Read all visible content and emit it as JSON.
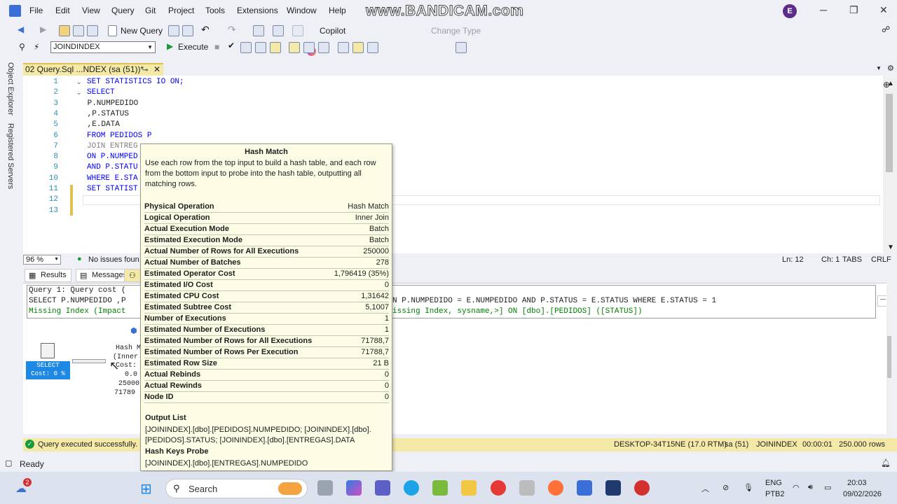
{
  "menu": [
    "File",
    "Edit",
    "View",
    "Query",
    "Git",
    "Project",
    "Tools",
    "Extensions",
    "Window",
    "Help"
  ],
  "watermark": "www.BANDICAM.com",
  "avatar_initial": "E",
  "toolbar": {
    "new_query": "New Query",
    "copilot": "Copilot",
    "change_type": "Change Type",
    "database": "JOINDINDEX",
    "execute": "Execute"
  },
  "left_panels": [
    "Object Explorer",
    "Registered Servers"
  ],
  "doc_tab": "02 Query.Sql ...NDEX (sa (51))*",
  "editor": {
    "lines": [
      {
        "n": "1",
        "text": "SET STATISTICS IO ON;"
      },
      {
        "n": "2",
        "text": "SELECT"
      },
      {
        "n": "3",
        "text": " P.NUMPEDIDO"
      },
      {
        "n": "4",
        "text": " ,P.STATUS"
      },
      {
        "n": "5",
        "text": " ,E.DATA"
      },
      {
        "n": "6",
        "text": "FROM PEDIDOS P"
      },
      {
        "n": "7",
        "text": "JOIN ENTREG"
      },
      {
        "n": "8",
        "text": "ON P.NUMPED"
      },
      {
        "n": "9",
        "text": "AND P.STATU"
      },
      {
        "n": "10",
        "text": "WHERE E.STA"
      },
      {
        "n": "11",
        "text": "SET STATIST"
      },
      {
        "n": "12",
        "text": ""
      },
      {
        "n": "13",
        "text": ""
      }
    ]
  },
  "editor_status": {
    "zoom": "96 %",
    "issues": "No issues foun",
    "ln": "Ln: 12",
    "ch": "Ch: 1",
    "tabs": "TABS",
    "crlf": "CRLF"
  },
  "result_tabs": [
    "Results",
    "Messages"
  ],
  "plan": {
    "line1": "Query 1: Query cost (",
    "line2": "SELECT P.NUMPEDIDO ,P",
    "line2_right": "N P.NUMPEDIDO = E.NUMPEDIDO AND P.STATUS = E.STATUS WHERE E.STATUS = 1",
    "line3": "Missing Index (Impact",
    "line3_right": "issing Index, sysname,>] ON [dbo].[PEDIDOS] ([STATUS])",
    "select_label": "SELECT",
    "select_cost": "Cost: 0 %",
    "hash_node": [
      "Hash M",
      "(Inner",
      "Cost:",
      "0.0",
      "25000",
      "71789"
    ]
  },
  "tooltip": {
    "title": "Hash Match",
    "description": "Use each row from the top input to build a hash table, and each row from the bottom input to probe into the hash table, outputting all matching rows.",
    "rows": [
      {
        "k": "Physical Operation",
        "v": "Hash Match"
      },
      {
        "k": "Logical Operation",
        "v": "Inner Join"
      },
      {
        "k": "Actual Execution Mode",
        "v": "Batch"
      },
      {
        "k": "Estimated Execution Mode",
        "v": "Batch"
      },
      {
        "k": "Actual Number of Rows for All Executions",
        "v": "250000"
      },
      {
        "k": "Actual Number of Batches",
        "v": "278"
      },
      {
        "k": "Estimated Operator Cost",
        "v": "1,796419 (35%)"
      },
      {
        "k": "Estimated I/O Cost",
        "v": "0"
      },
      {
        "k": "Estimated CPU Cost",
        "v": "1,31642"
      },
      {
        "k": "Estimated Subtree Cost",
        "v": "5,1007"
      },
      {
        "k": "Number of Executions",
        "v": "1"
      },
      {
        "k": "Estimated Number of Executions",
        "v": "1"
      },
      {
        "k": "Estimated Number of Rows for All Executions",
        "v": "71788,7"
      },
      {
        "k": "Estimated Number of Rows Per Execution",
        "v": "71788,7"
      },
      {
        "k": "Estimated Row Size",
        "v": "21 B"
      },
      {
        "k": "Actual Rebinds",
        "v": "0"
      },
      {
        "k": "Actual Rewinds",
        "v": "0"
      },
      {
        "k": "Node ID",
        "v": "0"
      }
    ],
    "output_list_title": "Output List",
    "output_list": "[JOININDEX].[dbo].[PEDIDOS].NUMPEDIDO; [JOININDEX].[dbo].[PEDIDOS].STATUS; [JOININDEX].[dbo].[ENTREGAS].DATA",
    "hash_keys_title": "Hash Keys Probe",
    "hash_keys": "[JOININDEX].[dbo].[ENTREGAS].NUMPEDIDO"
  },
  "query_status": {
    "message": "Query executed successfully.",
    "server": "DESKTOP-34T15NE (17.0 RTM)",
    "user": "sa (51)",
    "db": "JOININDEX",
    "time": "00:00:01",
    "rows": "250.000 rows"
  },
  "statusbar": {
    "ready": "Ready"
  },
  "taskbar": {
    "search": "Search",
    "badge": "2",
    "lang": "ENG",
    "layout": "PTB2",
    "time": "20:03",
    "date": "09/02/2026"
  }
}
